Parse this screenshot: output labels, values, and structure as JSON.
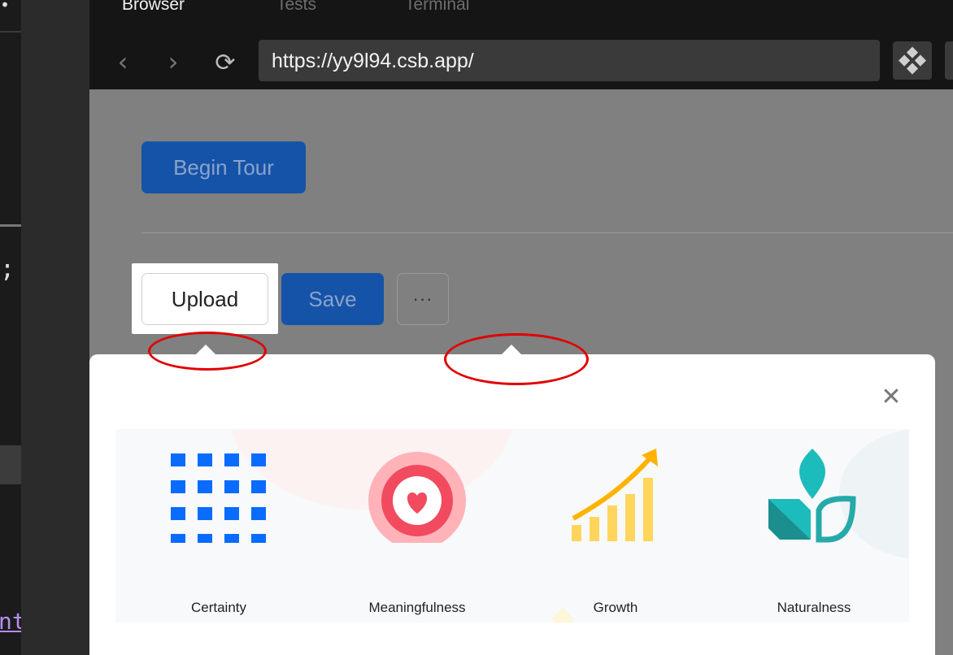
{
  "tabs": [
    {
      "label": "Browser",
      "active": true
    },
    {
      "label": "Tests",
      "active": false
    },
    {
      "label": "Terminal",
      "active": false
    }
  ],
  "address_bar": {
    "url": "https://yy9l94.csb.app/"
  },
  "nav": {
    "back_icon": "‹",
    "forward_icon": "›",
    "reload_icon": "⟳"
  },
  "editor": {
    "dot": "•",
    "semicolon": ";",
    "fragment": "nt"
  },
  "page": {
    "begin_tour_label": "Begin Tour",
    "upload_label": "Upload",
    "save_label": "Save",
    "more_label": "···"
  },
  "tour_panel": {
    "close_icon": "✕",
    "features": [
      {
        "label": "Certainty",
        "icon": "grid-icon"
      },
      {
        "label": "Meaningfulness",
        "icon": "heart-target-icon"
      },
      {
        "label": "Growth",
        "icon": "growth-chart-icon"
      },
      {
        "label": "Naturalness",
        "icon": "leaf-icon"
      }
    ]
  },
  "colors": {
    "primary": "#1553a8",
    "annotation_ring": "#e00000",
    "grid_blue": "#0a6cff",
    "heart_red": "#f24a5e",
    "growth_yellow": "#ffd55c",
    "leaf_teal": "#1dbcbc"
  }
}
